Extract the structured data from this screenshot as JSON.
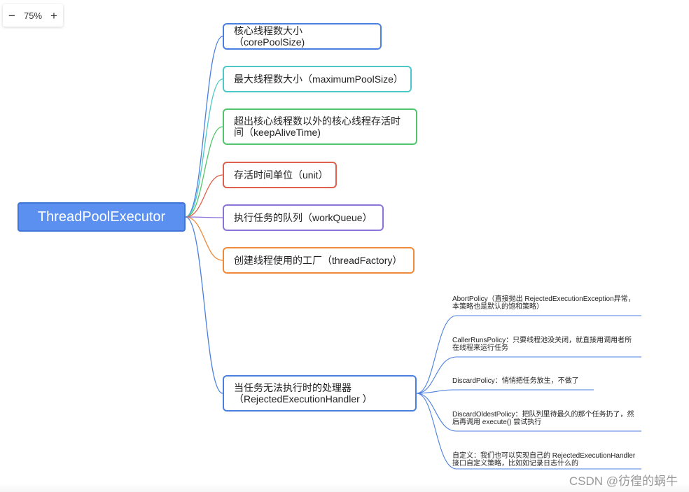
{
  "zoom": {
    "minus": "−",
    "value": "75%",
    "plus": "+"
  },
  "root": {
    "label": "ThreadPoolExecutor"
  },
  "branches": [
    {
      "label": "核心线程数大小（corePoolSize)",
      "color": "#4a7fe0"
    },
    {
      "label": "最大线程数大小（maximumPoolSize）",
      "color": "#4cc8c8"
    },
    {
      "label": "超出核心线程数以外的核心线程存活时间（keepAliveTime)",
      "color": "#52c56c"
    },
    {
      "label": "存活时间单位（unit）",
      "color": "#e0604f"
    },
    {
      "label": "执行任务的队列（workQueue）",
      "color": "#8b74d8"
    },
    {
      "label": "创建线程使用的工厂（threadFactory）",
      "color": "#ef8a3c"
    },
    {
      "label": "当任务无法执行时的处理器（RejectedExecutionHandler ）",
      "color": "#4a7fe0"
    }
  ],
  "policies": [
    {
      "label": "AbortPolicy（直接抛出 RejectedExecutionException异常，本策略也是默认的饱和策略）"
    },
    {
      "label": "CallerRunsPolicy：只要线程池没关闭，就直接用调用者所在线程来运行任务"
    },
    {
      "label": "DiscardPolicy：悄悄把任务放生，不做了"
    },
    {
      "label": "DiscardOldestPolicy：把队列里待最久的那个任务扔了，然后再调用 execute() 尝试执行"
    },
    {
      "label": "自定义：我们也可以实现自己的 RejectedExecutionHandler 接口自定义策略，比如如记录日志什么的"
    }
  ],
  "watermark": "CSDN @彷徨的蜗牛"
}
